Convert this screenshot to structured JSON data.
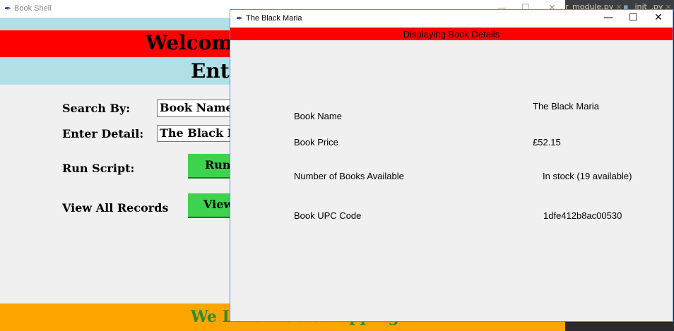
{
  "editor": {
    "tabs": [
      {
        "label": "r_module.py",
        "close": "×"
      },
      {
        "label": "_init_.py",
        "close": "×"
      }
    ]
  },
  "main_window": {
    "title": "Book Shell",
    "controls": {
      "minimize": "—",
      "maximize": "☐",
      "close": "✕"
    },
    "welcome": "Welcome",
    "enter": "Ent",
    "form": {
      "search_by_label": "Search By:",
      "search_by_value": "Book Name",
      "enter_detail_label": "Enter Detail:",
      "enter_detail_value": "The Black M",
      "run_script_label": "Run Script:",
      "run_button": "Run",
      "view_all_label": "View All Records",
      "view_button": "View"
    },
    "footer": "We Love Web Scrapping"
  },
  "popup": {
    "title": "The Black Maria",
    "controls": {
      "minimize": "—",
      "maximize": "☐",
      "close": "✕"
    },
    "header": "Displaying Book Details",
    "details": [
      {
        "label": "Book Name",
        "value": "The Black Maria"
      },
      {
        "label": "Book Price",
        "value": "£52.15"
      },
      {
        "label": "Number of Books Available",
        "value": "In stock (19 available)"
      },
      {
        "label": "Book UPC Code",
        "value": "1dfe412b8ac00530"
      }
    ]
  },
  "colors": {
    "header_red": "#ff0000",
    "light_blue": "#b0e0e6",
    "button_green": "#3dd34f",
    "footer_orange": "#ffa500",
    "footer_text_green": "#2e8b2e"
  },
  "icons": {
    "app_icon": "feather-icon"
  }
}
